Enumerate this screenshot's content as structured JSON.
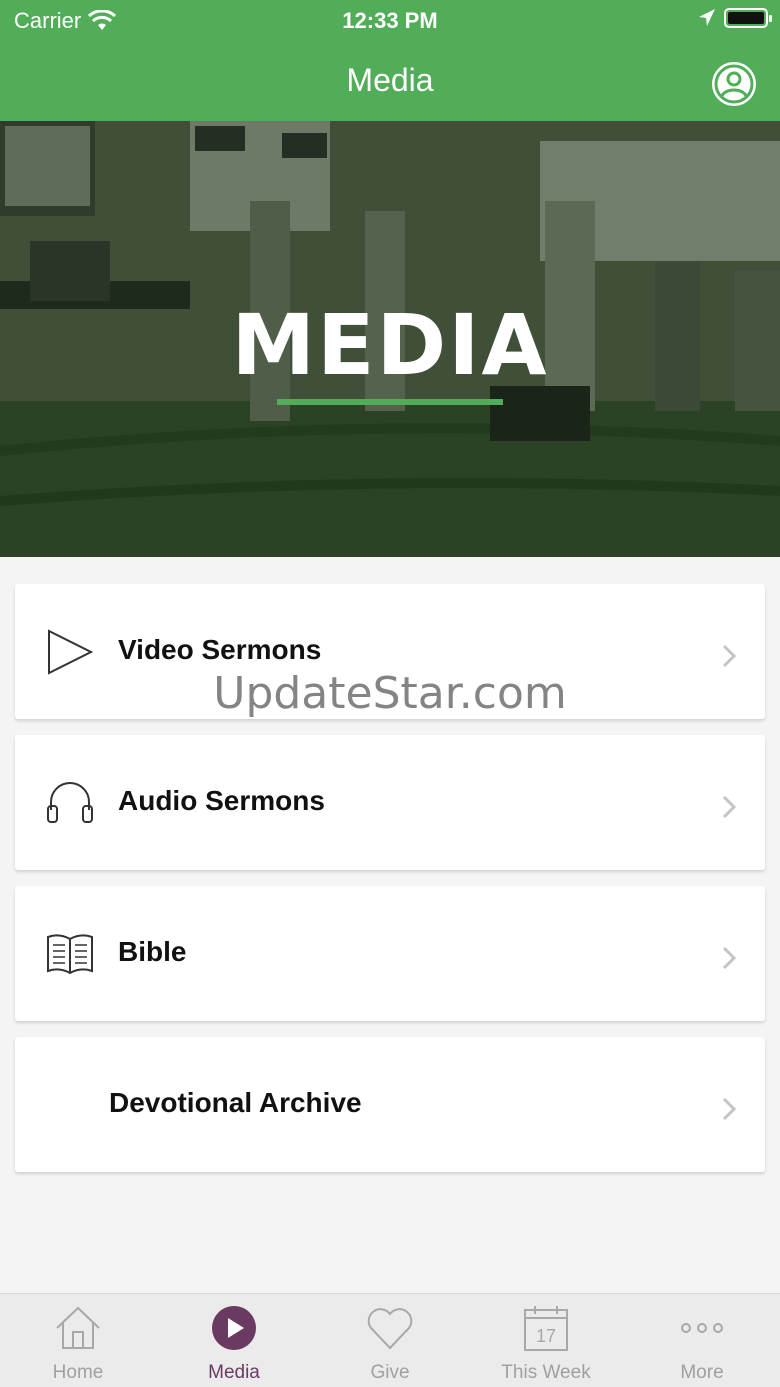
{
  "status_bar": {
    "carrier": "Carrier",
    "time": "12:33 PM"
  },
  "header": {
    "title": "Media"
  },
  "hero": {
    "title": "MEDIA",
    "accent_color": "#52ad58"
  },
  "menu": {
    "items": [
      {
        "label": "Video Sermons",
        "icon": "play-icon"
      },
      {
        "label": "Audio Sermons",
        "icon": "headphones-icon"
      },
      {
        "label": "Bible",
        "icon": "book-icon"
      },
      {
        "label": "Devotional Archive",
        "icon": ""
      }
    ]
  },
  "watermark": "UpdateStar.com",
  "tabbar": {
    "active_color": "#6b3a63",
    "tabs": [
      {
        "label": "Home",
        "icon": "home-icon"
      },
      {
        "label": "Media",
        "icon": "play-circle-icon",
        "active": true
      },
      {
        "label": "Give",
        "icon": "heart-icon"
      },
      {
        "label": "This Week",
        "icon": "calendar-icon",
        "day": "17"
      },
      {
        "label": "More",
        "icon": "more-icon"
      }
    ]
  },
  "colors": {
    "brand_green": "#52ad58",
    "background": "#f4f4f4"
  }
}
